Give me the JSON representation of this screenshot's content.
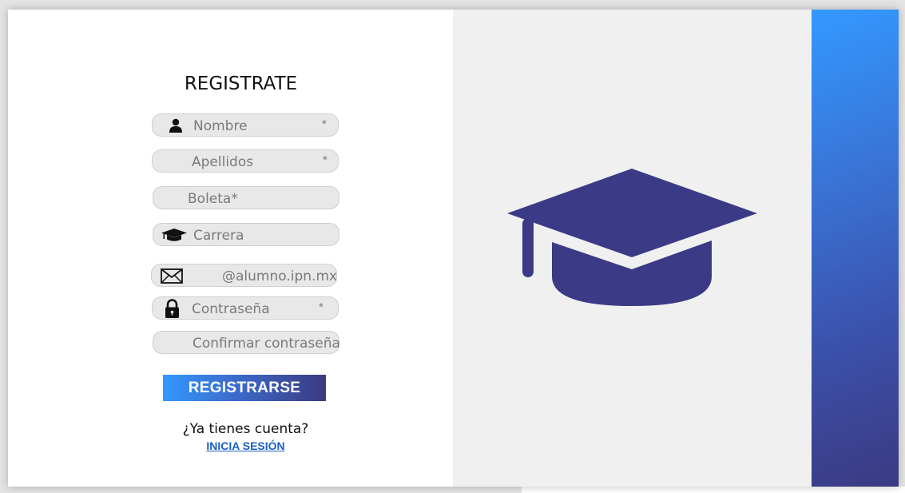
{
  "form": {
    "title": "REGISTRATE",
    "fields": {
      "nombre": {
        "placeholder": "Nombre",
        "required_mark": "*"
      },
      "apellidos": {
        "placeholder": "Apellidos",
        "required_mark": "*"
      },
      "boleta": {
        "placeholder": "Boleta*"
      },
      "carrera": {
        "placeholder": "Carrera"
      },
      "email": {
        "placeholder": "@alumno.ipn.mx"
      },
      "password": {
        "placeholder": "Contraseña",
        "required_mark": "*"
      },
      "confirm_password": {
        "placeholder": "Confirmar contraseña"
      }
    },
    "submit_label": "REGISTRARSE"
  },
  "footer": {
    "question": "¿Ya tienes cuenta?",
    "login_link": "INICIA SESIÓN"
  },
  "icons": {
    "user": "user-icon",
    "cap_small": "graduation-cap-icon",
    "mail": "envelope-icon",
    "lock": "lock-icon",
    "cap_large": "graduation-cap-illustration"
  },
  "colors": {
    "accent_light": "#3399ff",
    "accent_dark": "#3b3a82",
    "field_bg": "#e8e8e8",
    "panel_bg": "#f0f0f0",
    "link": "#1a5fc7"
  }
}
